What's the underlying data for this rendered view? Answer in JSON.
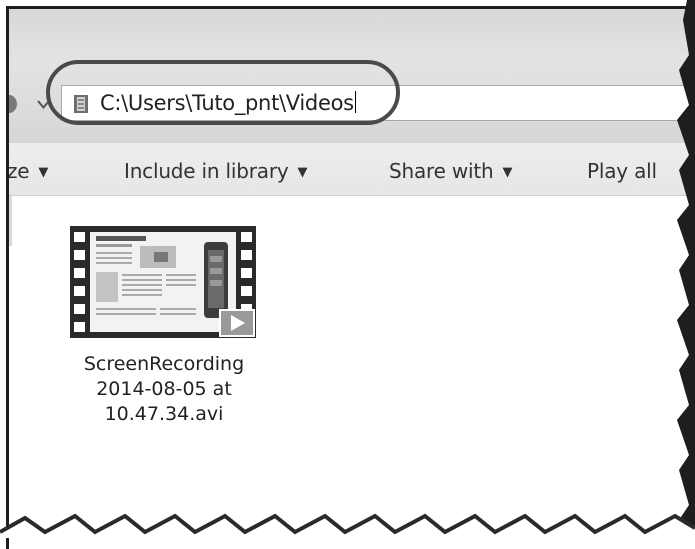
{
  "address_bar": {
    "path": "C:\\Users\\Tuto_pnt\\Videos"
  },
  "toolbar": {
    "organize_label": "ze",
    "include_label": "Include in library",
    "share_label": "Share with",
    "playall_label": "Play all"
  },
  "files": [
    {
      "name": "ScreenRecording\n2014-08-05 at\n10.47.34.avi"
    }
  ],
  "icons": {
    "folder": "folder-icon",
    "dropdown": "chevron-down-icon",
    "video_thumb": "video-file-icon",
    "play_badge": "play-icon"
  }
}
